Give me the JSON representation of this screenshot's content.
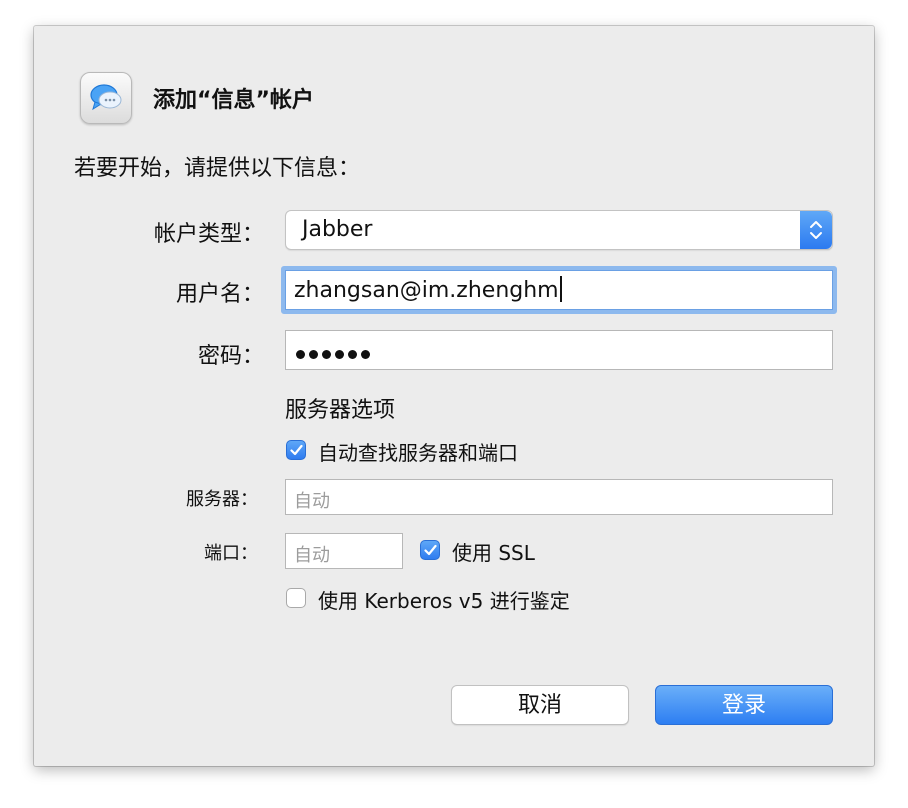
{
  "dialog": {
    "title": "添加“信息”帐户",
    "intro": "若要开始，请提供以下信息："
  },
  "form": {
    "account_type_label": "帐户类型：",
    "account_type_value": "Jabber",
    "username_label": "用户名：",
    "username_value": "zhangsan@im.zhenghm",
    "password_label": "密码：",
    "password_dot_count": 6
  },
  "server_options": {
    "heading": "服务器选项",
    "auto_find_label": "自动查找服务器和端口",
    "auto_find_checked": true,
    "server_label": "服务器：",
    "server_placeholder": "自动",
    "port_label": "端口：",
    "port_placeholder": "自动",
    "ssl_label": "使用 SSL",
    "ssl_checked": true,
    "kerberos_label": "使用 Kerberos v5 进行鉴定",
    "kerberos_checked": false
  },
  "buttons": {
    "cancel": "取消",
    "login": "登录"
  },
  "icons": {
    "app": "messages-bubble-icon",
    "popup_arrows": "up-down-chevron-icon",
    "checkmark": "checkmark-icon"
  },
  "colors": {
    "accent": "#2f7cf0",
    "focus_ring": "#8db9ee",
    "dialog_bg": "#ececec"
  }
}
